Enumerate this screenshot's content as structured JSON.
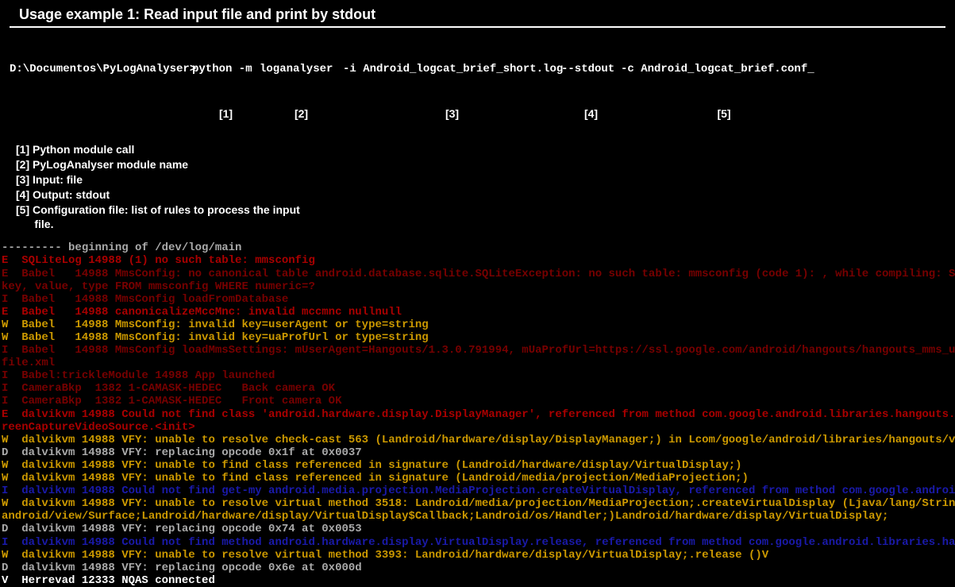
{
  "header": {
    "title": "Usage example 1: Read input file and print by stdout"
  },
  "cmd": {
    "prompt": "D:\\Documentos\\PyLogAnalyser>",
    "parts": {
      "p1": "python -m",
      "p2": "loganalyser",
      "p3": "-i Android_logcat_brief_short.log",
      "p4": "--stdout",
      "p5": "-c Android_logcat_brief.conf_"
    },
    "annot": {
      "a1": "[1]",
      "a2": "[2]",
      "a3": "[3]",
      "a4": "[4]",
      "a5": "[5]"
    }
  },
  "legend": {
    "l1": "[1] Python module call",
    "l2": "[2] PyLogAnalyser module name",
    "l3": "[3] Input: file",
    "l4": "[4] Output: stdout",
    "l5": "[5] Configuration file: list of rules to process the input",
    "l5b": "      file."
  },
  "log": {
    "lines": [
      {
        "cls": "grey",
        "t": "--------- beginning of /dev/log/main"
      },
      {
        "cls": "red",
        "t": "E  SQLiteLog 14988 (1) no such table: mmsconfig"
      },
      {
        "cls": "darkred",
        "t": "E  Babel   14988 MmsConfig: no canonical table android.database.sqlite.SQLiteException: no such table: mmsconfig (code 1): , while compiling: SELECT"
      },
      {
        "cls": "darkred",
        "t": "key, value, type FROM mmsconfig WHERE numeric=?"
      },
      {
        "cls": "darkred",
        "t": "I  Babel   14988 MmsConfig loadFromDatabase"
      },
      {
        "cls": "red",
        "t": "E  Babel   14988 canonicalizeMccMnc: invalid mccmnc nullnull"
      },
      {
        "cls": "yellow",
        "t": "W  Babel   14988 MmsConfig: invalid key=userAgent or type=string"
      },
      {
        "cls": "yellow",
        "t": "W  Babel   14988 MmsConfig: invalid key=uaProfUrl or type=string"
      },
      {
        "cls": "darkred",
        "t": "I  Babel   14988 MmsConfig loadMmsSettings: mUserAgent=Hangouts/1.3.0.791994, mUaProfUrl=https://ssl.google.com/android/hangouts/hangouts_mms_ua_pro"
      },
      {
        "cls": "darkred",
        "t": "file.xml"
      },
      {
        "cls": "darkred",
        "t": "I  Babel:trickleModule 14988 App launched"
      },
      {
        "cls": "darkred",
        "t": "I  CameraBkp  1382 1-CAMASK-HEDEC   Back camera OK"
      },
      {
        "cls": "darkred",
        "t": "I  CameraBkp  1382 1-CAMASK-HEDEC   Front camera OK"
      },
      {
        "cls": "red",
        "t": "E  dalvikvm 14988 Could not find class 'android.hardware.display.DisplayManager', referenced from method com.google.android.libraries.hangouts.video.Sc"
      },
      {
        "cls": "red",
        "t": "reenCaptureVideoSource.<init>"
      },
      {
        "cls": "yellow",
        "t": "W  dalvikvm 14988 VFY: unable to resolve check-cast 563 (Landroid/hardware/display/DisplayManager;) in Lcom/google/android/libraries/hangouts/video/Sc"
      },
      {
        "cls": "grey",
        "t": "D  dalvikvm 14988 VFY: replacing opcode 0x1f at 0x0037"
      },
      {
        "cls": "yellow",
        "t": "W  dalvikvm 14988 VFY: unable to find class referenced in signature (Landroid/hardware/display/VirtualDisplay;)"
      },
      {
        "cls": "yellow",
        "t": "W  dalvikvm 14988 VFY: unable to find class referenced in signature (Landroid/media/projection/MediaProjection;)"
      },
      {
        "cls": "blue",
        "t": "I  dalvikvm 14988 Could not find get-my android.media.projection.MediaProjection.createVirtualDisplay, referenced from method com.google.android.libra"
      },
      {
        "cls": "yellow",
        "t": "W  dalvikvm 14988 VFY: unable to resolve virtual method 3518: Landroid/media/projection/MediaProjection;.createVirtualDisplay (Ljava/lang/String;IIIIL"
      },
      {
        "cls": "yellow",
        "t": "android/view/Surface;Landroid/hardware/display/VirtualDisplay$Callback;Landroid/os/Handler;)Landroid/hardware/display/VirtualDisplay;"
      },
      {
        "cls": "grey",
        "t": "D  dalvikvm 14988 VFY: replacing opcode 0x74 at 0x0053"
      },
      {
        "cls": "blue",
        "t": "I  dalvikvm 14988 Could not find method android.hardware.display.VirtualDisplay.release, referenced from method com.google.android.libraries.hangouts"
      },
      {
        "cls": "yellow",
        "t": "W  dalvikvm 14988 VFY: unable to resolve virtual method 3393: Landroid/hardware/display/VirtualDisplay;.release ()V"
      },
      {
        "cls": "grey",
        "t": "D  dalvikvm 14988 VFY: replacing opcode 0x6e at 0x000d"
      },
      {
        "cls": "white",
        "t": "V  Herrevad 12333 NQAS connected"
      }
    ]
  }
}
